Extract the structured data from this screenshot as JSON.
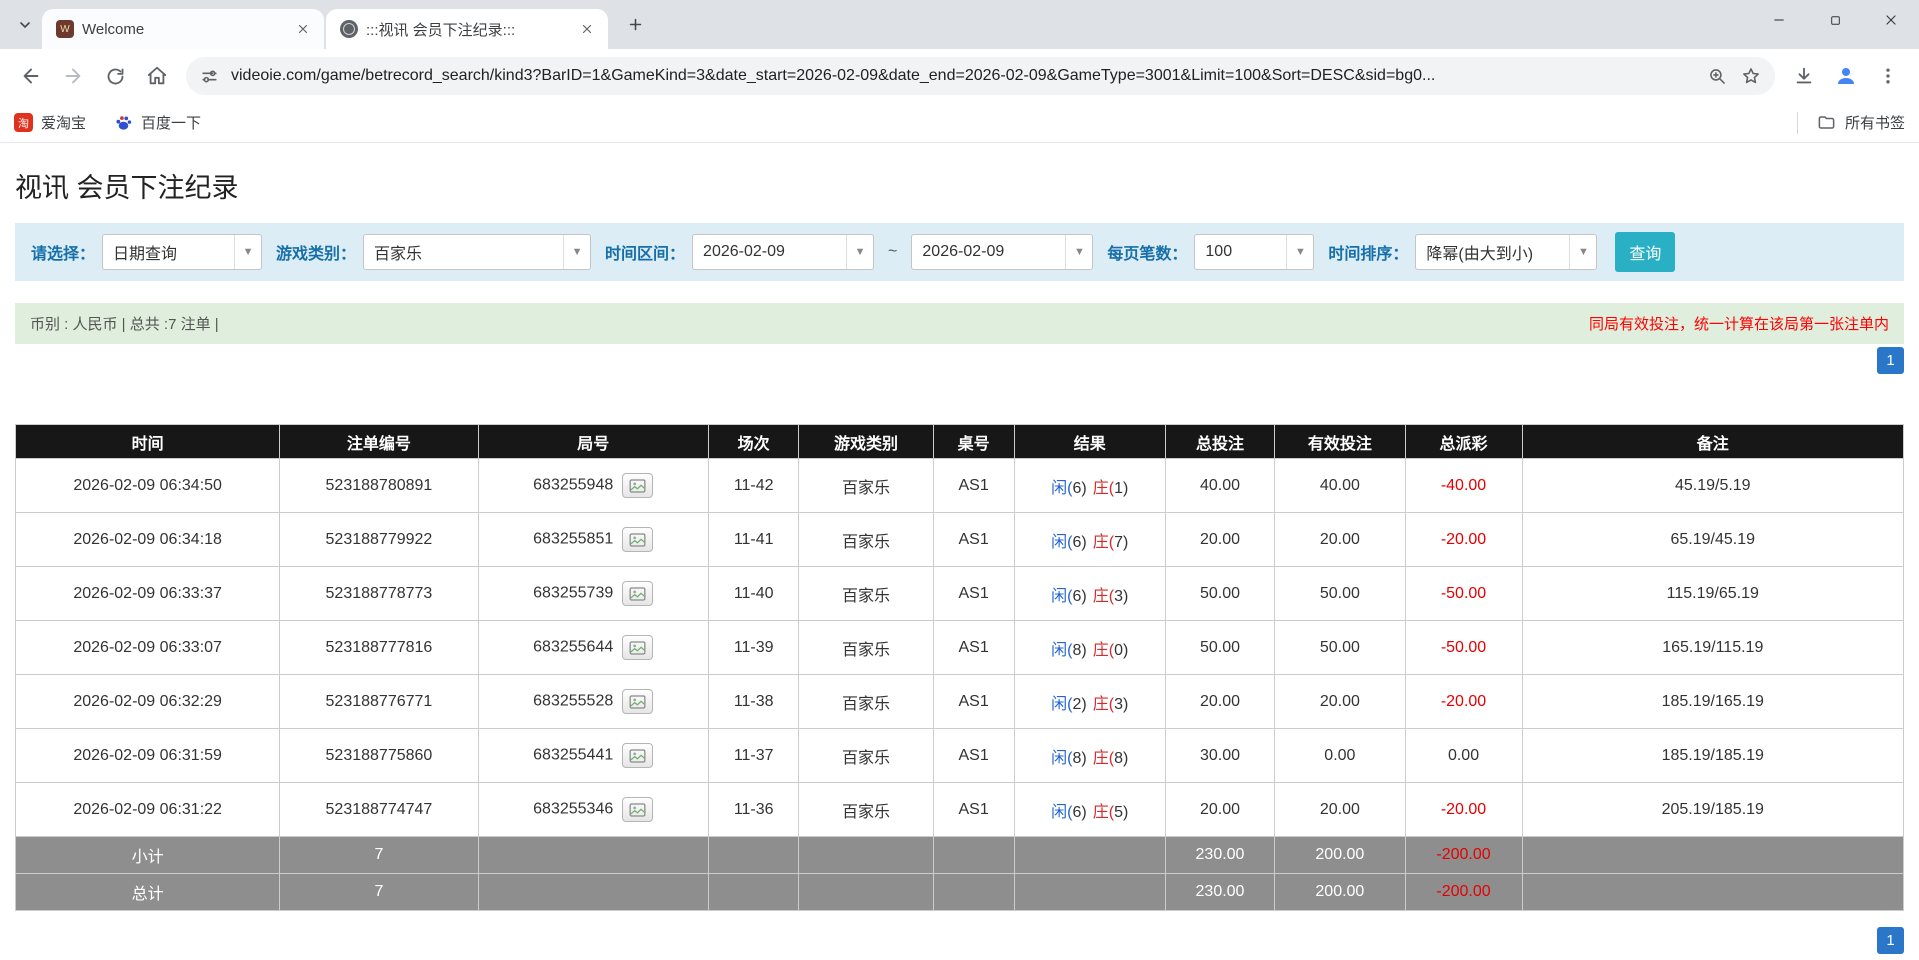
{
  "icons": {
    "dropdown_caret": "▼"
  },
  "browser": {
    "tabs": [
      {
        "title": "Welcome",
        "favicon_text": "W"
      },
      {
        "title": ":::视讯 会员下注纪录:::",
        "favicon_text": ""
      }
    ],
    "url": "videoie.com/game/betrecord_search/kind3?BarID=1&GameKind=3&date_start=2026-02-09&date_end=2026-02-09&GameType=3001&Limit=100&Sort=DESC&sid=bg0...",
    "bookmarks": [
      {
        "label": "爱淘宝",
        "icon_text": "淘"
      },
      {
        "label": "百度一下"
      }
    ],
    "all_bookmarks_label": "所有书签"
  },
  "page": {
    "title": "视讯 会员下注纪录",
    "filters": {
      "select_label": "请选择：",
      "select_value": "日期查询",
      "game_kind_label": "游戏类别：",
      "game_kind_value": "百家乐",
      "date_range_label": "时间区间：",
      "date_start": "2026-02-09",
      "date_separator": "~",
      "date_end": "2026-02-09",
      "per_page_label": "每页笔数：",
      "per_page_value": "100",
      "sort_label": "时间排序：",
      "sort_value": "降幂(由大到小)",
      "search_button": "查询"
    },
    "summary": {
      "left": "币别 : 人民币 | 总共 :7 注单 |",
      "right": "同局有效投注，统一计算在该局第一张注单内"
    },
    "pagination": {
      "page": "1"
    },
    "table": {
      "headers": [
        "时间",
        "注单编号",
        "局号",
        "场次",
        "游戏类别",
        "桌号",
        "结果",
        "总投注",
        "有效投注",
        "总派彩",
        "备注"
      ],
      "rows": [
        {
          "time": "2026-02-09 06:34:50",
          "bet_id": "523188780891",
          "round": "683255948",
          "session": "11-42",
          "game": "百家乐",
          "table_no": "AS1",
          "result": {
            "player": "闲(6)",
            "banker": "庄(1)"
          },
          "total_bet": "40.00",
          "valid_bet": "40.00",
          "payout": "-40.00",
          "note": "45.19/5.19"
        },
        {
          "time": "2026-02-09 06:34:18",
          "bet_id": "523188779922",
          "round": "683255851",
          "session": "11-41",
          "game": "百家乐",
          "table_no": "AS1",
          "result": {
            "player": "闲(6)",
            "banker": "庄(7)"
          },
          "total_bet": "20.00",
          "valid_bet": "20.00",
          "payout": "-20.00",
          "note": "65.19/45.19"
        },
        {
          "time": "2026-02-09 06:33:37",
          "bet_id": "523188778773",
          "round": "683255739",
          "session": "11-40",
          "game": "百家乐",
          "table_no": "AS1",
          "result": {
            "player": "闲(6)",
            "banker": "庄(3)"
          },
          "total_bet": "50.00",
          "valid_bet": "50.00",
          "payout": "-50.00",
          "note": "115.19/65.19"
        },
        {
          "time": "2026-02-09 06:33:07",
          "bet_id": "523188777816",
          "round": "683255644",
          "session": "11-39",
          "game": "百家乐",
          "table_no": "AS1",
          "result": {
            "player": "闲(8)",
            "banker": "庄(0)"
          },
          "total_bet": "50.00",
          "valid_bet": "50.00",
          "payout": "-50.00",
          "note": "165.19/115.19"
        },
        {
          "time": "2026-02-09 06:32:29",
          "bet_id": "523188776771",
          "round": "683255528",
          "session": "11-38",
          "game": "百家乐",
          "table_no": "AS1",
          "result": {
            "player": "闲(2)",
            "banker": "庄(3)"
          },
          "total_bet": "20.00",
          "valid_bet": "20.00",
          "payout": "-20.00",
          "note": "185.19/165.19"
        },
        {
          "time": "2026-02-09 06:31:59",
          "bet_id": "523188775860",
          "round": "683255441",
          "session": "11-37",
          "game": "百家乐",
          "table_no": "AS1",
          "result": {
            "player": "闲(8)",
            "banker": "庄(8)"
          },
          "total_bet": "30.00",
          "valid_bet": "0.00",
          "payout": "0.00",
          "note": "185.19/185.19"
        },
        {
          "time": "2026-02-09 06:31:22",
          "bet_id": "523188774747",
          "round": "683255346",
          "session": "11-36",
          "game": "百家乐",
          "table_no": "AS1",
          "result": {
            "player": "闲(6)",
            "banker": "庄(5)"
          },
          "total_bet": "20.00",
          "valid_bet": "20.00",
          "payout": "-20.00",
          "note": "205.19/185.19"
        }
      ],
      "subtotal": {
        "label": "小计",
        "count": "7",
        "total_bet": "230.00",
        "valid_bet": "200.00",
        "payout": "-200.00"
      },
      "total": {
        "label": "总计",
        "count": "7",
        "total_bet": "230.00",
        "valid_bet": "200.00",
        "payout": "-200.00"
      }
    }
  }
}
